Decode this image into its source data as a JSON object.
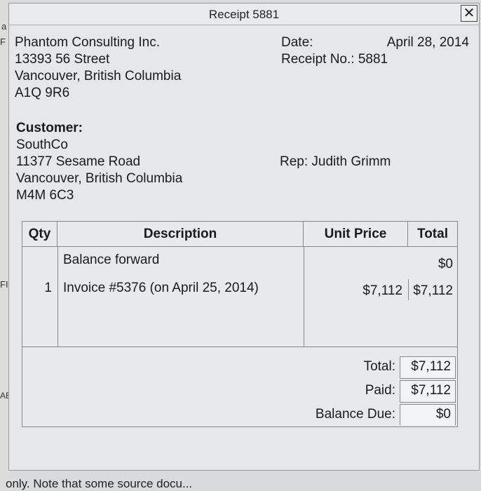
{
  "window": {
    "title": "Receipt 5881",
    "close_symbol": "✕"
  },
  "company": {
    "name": "Phantom Consulting Inc.",
    "street": "13393 56 Street",
    "city": "Vancouver, British Columbia",
    "postal": "A1Q 9R6"
  },
  "receipt": {
    "date_label": "Date:",
    "date_value": "April 28, 2014",
    "receipt_no_label": "Receipt No.:",
    "receipt_no_value": "5881"
  },
  "customer": {
    "heading": "Customer:",
    "name": "SouthCo",
    "street": "11377 Sesame Road",
    "city": "Vancouver, British Columbia",
    "postal": "M4M 6C3"
  },
  "rep": "Rep: Judith Grimm",
  "table": {
    "headers": {
      "qty": "Qty",
      "description": "Description",
      "unit_price": "Unit Price",
      "total": "Total"
    },
    "rows": [
      {
        "qty": "",
        "description": "Balance forward",
        "unit_price": "",
        "total": "$0"
      },
      {
        "qty": "1",
        "description": "Invoice #5376 (on April 25, 2014)",
        "unit_price": "$7,112",
        "total": "$7,112"
      }
    ]
  },
  "totals": {
    "total_label": "Total:",
    "total_value": "$7,112",
    "paid_label": "Paid:",
    "paid_value": "$7,112",
    "balance_label": "Balance Due:",
    "balance_value": "$0"
  },
  "background": {
    "left_fragments": [
      "a",
      "F",
      "FI",
      "AB"
    ],
    "bottom_note": "only. Note that some source docu..."
  }
}
